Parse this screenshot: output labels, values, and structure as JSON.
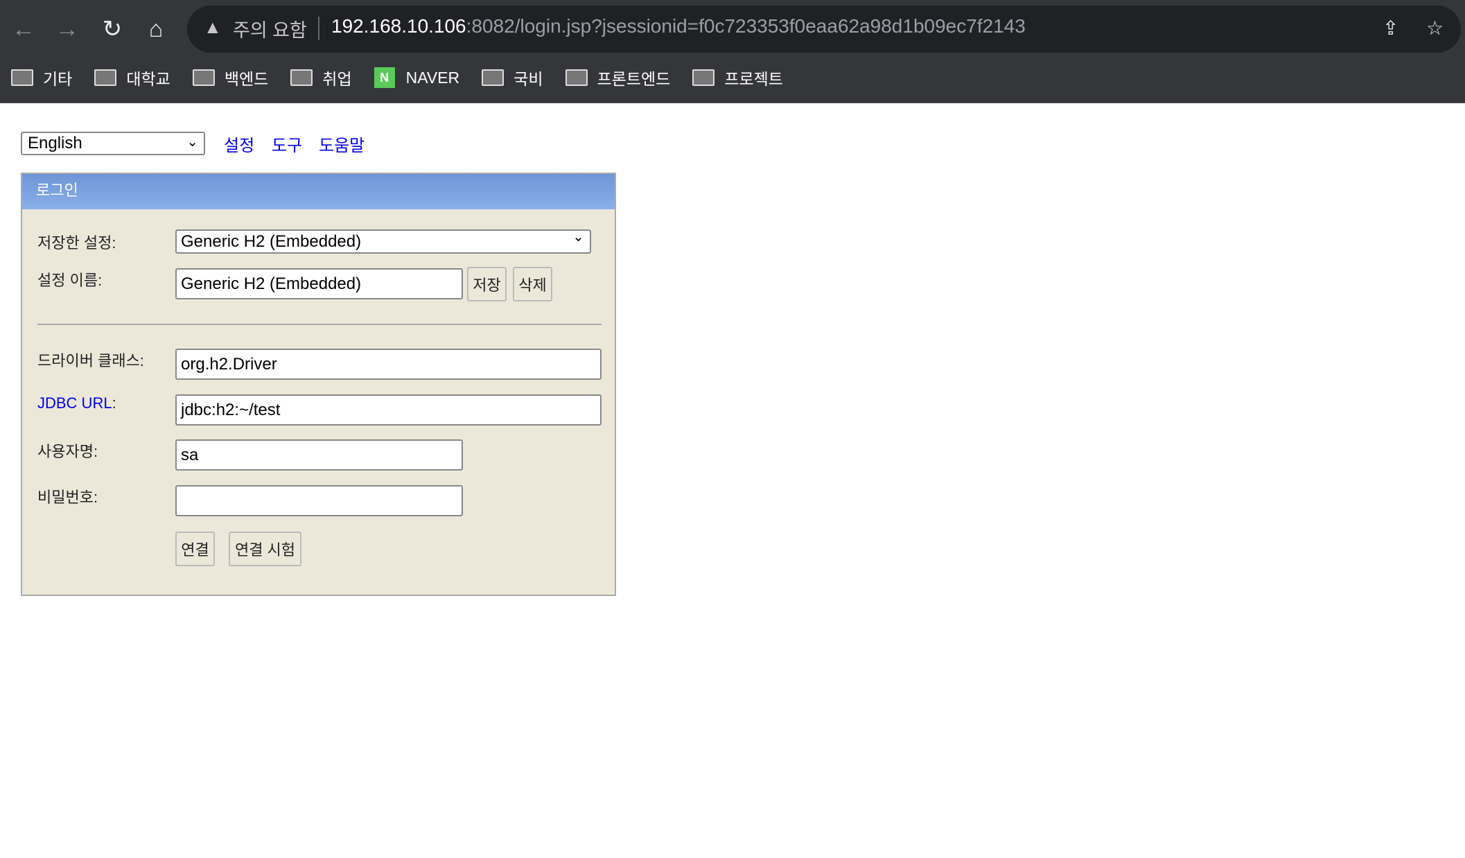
{
  "browser": {
    "security_label": "주의 요함",
    "url_host": "192.168.10.106",
    "url_rest": ":8082/login.jsp?jsessionid=f0c723353f0eaa62a98d1b09ec7f2143",
    "bookmarks": [
      {
        "label": "기타",
        "icon": "folder-icon"
      },
      {
        "label": "대학교",
        "icon": "folder-icon"
      },
      {
        "label": "백엔드",
        "icon": "folder-icon"
      },
      {
        "label": "취업",
        "icon": "folder-icon"
      },
      {
        "label": "NAVER",
        "icon": "naver-icon"
      },
      {
        "label": "국비",
        "icon": "folder-icon"
      },
      {
        "label": "프론트엔드",
        "icon": "folder-icon"
      },
      {
        "label": "프로젝트",
        "icon": "folder-icon"
      }
    ],
    "naver_letter": "N"
  },
  "top": {
    "language": "English",
    "links": [
      "설정",
      "도구",
      "도움말"
    ]
  },
  "login": {
    "title": "로그인",
    "saved_settings_label": "저장한 설정:",
    "saved_settings_value": "Generic H2 (Embedded)",
    "setting_name_label": "설정 이름:",
    "setting_name_value": "Generic H2 (Embedded)",
    "save_button": "저장",
    "delete_button": "삭제",
    "driver_label": "드라이버 클래스:",
    "driver_value": "org.h2.Driver",
    "jdbc_label": "JDBC URL",
    "jdbc_colon": ":",
    "jdbc_value": "jdbc:h2:~/test",
    "user_label": "사용자명:",
    "user_value": "sa",
    "password_label": "비밀번호:",
    "password_value": "",
    "connect_button": "연결",
    "test_button": "연결 시험"
  },
  "colors": {
    "header": "#7aa3e2",
    "panel": "#ebe8da",
    "link": "#0000ee"
  }
}
